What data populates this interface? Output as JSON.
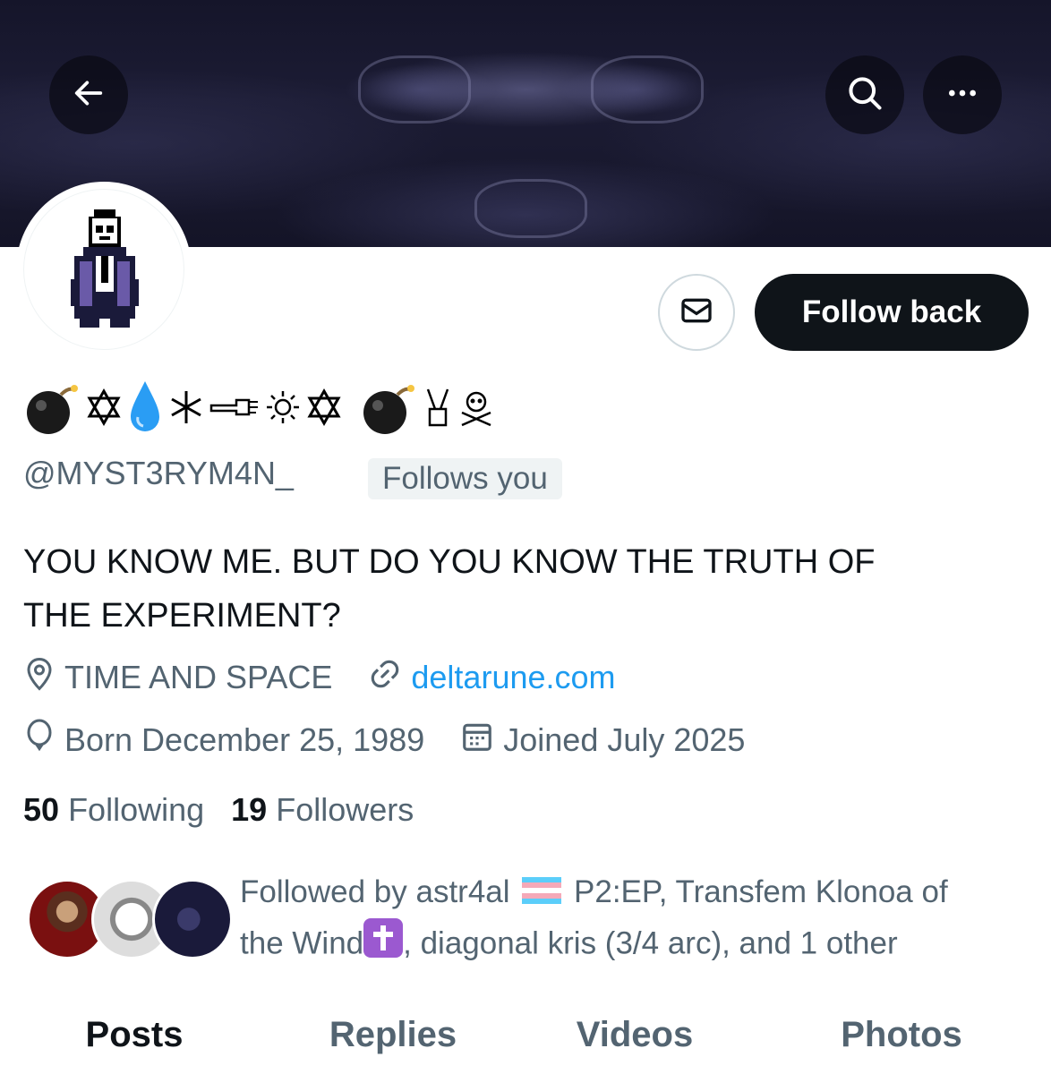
{
  "header": {
    "back_icon": "arrow-left-icon",
    "search_icon": "search-icon",
    "more_icon": "more-horizontal-icon"
  },
  "profile": {
    "display_name_icons": [
      "bomb-icon",
      "star-of-david-icon",
      "droplet-icon",
      "snowflake-icon",
      "pointing-hand-icon",
      "sun-icon",
      "star-of-david-icon",
      "bomb-icon",
      "victory-hand-icon",
      "skull-crossbones-icon"
    ],
    "handle": "@MYST3RYM4N_",
    "follows_you": "Follows you",
    "bio_line1": "YOU KNOW ME. BUT DO YOU KNOW THE TRUTH OF",
    "bio_line2": "THE EXPERIMENT?",
    "location": "TIME AND SPACE",
    "website": "deltarune.com",
    "birthday": "Born December 25, 1989",
    "joined": "Joined July 2025"
  },
  "actions": {
    "message_icon": "mail-icon",
    "follow_back": "Follow back"
  },
  "stats": {
    "following_count": "50",
    "following_label": "Following",
    "followers_count": "19",
    "followers_label": "Followers"
  },
  "followed_by": {
    "prefix": "Followed by astr4al",
    "flag_icon": "transgender-flag-icon",
    "part2": "P2:EP, Transfem Klonoa of",
    "part3": "the Wind",
    "cross_icon": "latin-cross-icon",
    "part4": ", diagonal kris (3/4 arc), and 1 other"
  },
  "tabs": [
    "Posts",
    "Replies",
    "Videos",
    "Photos"
  ],
  "colors": {
    "accent": "#1d9bf0",
    "text": "#0f1419",
    "secondary": "#536471"
  }
}
